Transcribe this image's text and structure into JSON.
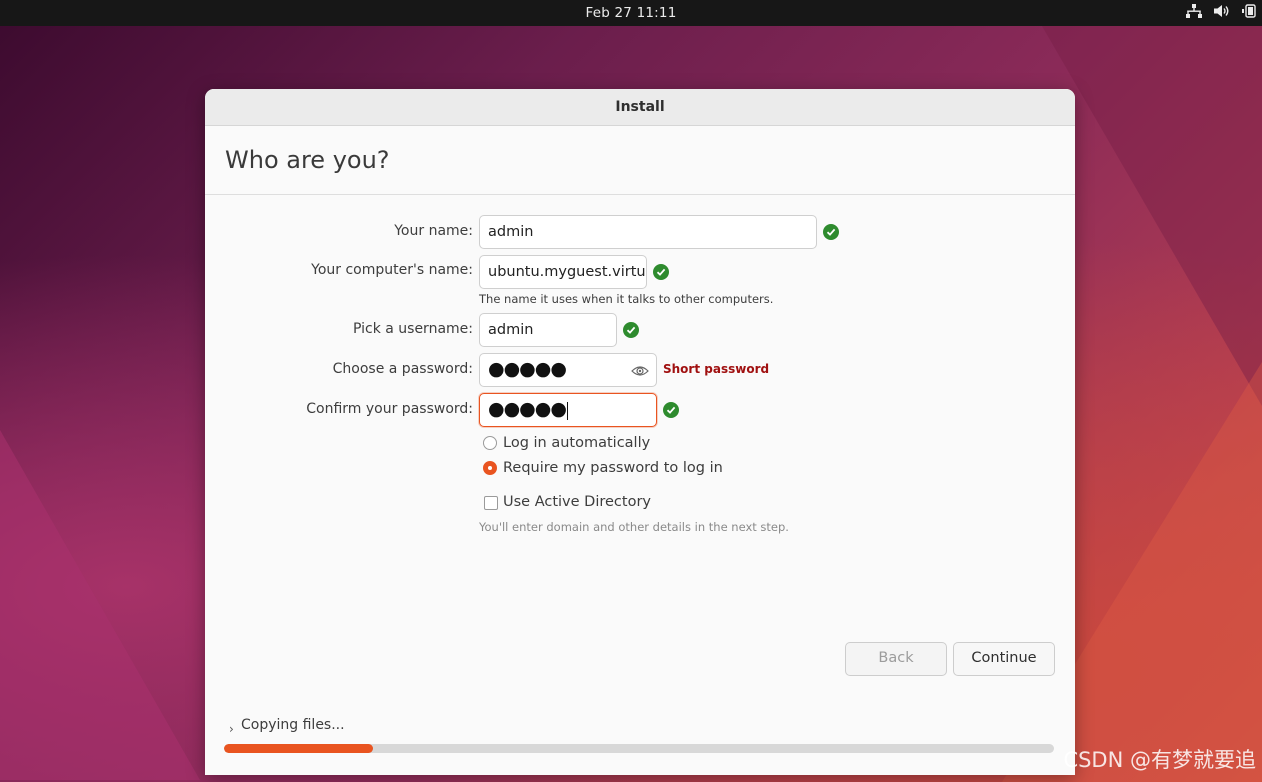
{
  "topbar": {
    "clock": "Feb 27  11:11"
  },
  "window": {
    "title": "Install"
  },
  "page": {
    "heading": "Who are you?"
  },
  "form": {
    "name_label": "Your name:",
    "name_value": "admin",
    "computer_label": "Your computer's name:",
    "computer_value": "ubuntu.myguest.virtua",
    "computer_hint": "The name it uses when it talks to other computers.",
    "username_label": "Pick a username:",
    "username_value": "admin",
    "password_label": "Choose a password:",
    "password_mask": "●●●●●",
    "password_strength": "Short password",
    "confirm_label": "Confirm your password:",
    "confirm_mask": "●●●●●",
    "login_auto_label": "Log in automatically",
    "login_require_label": "Require my password to log in",
    "login_selected": "Require my password to log in",
    "active_directory_label": "Use Active Directory",
    "active_directory_checked": false,
    "active_directory_hint": "You'll enter domain and other details in the next step."
  },
  "buttons": {
    "back": "Back",
    "continue": "Continue"
  },
  "status": {
    "label": "Copying files...",
    "progress": 0.18
  },
  "watermark": "CSDN @有梦就要追",
  "colors": {
    "accent": "#e95420",
    "valid": "#2e8b2e",
    "warning": "#a01010"
  }
}
